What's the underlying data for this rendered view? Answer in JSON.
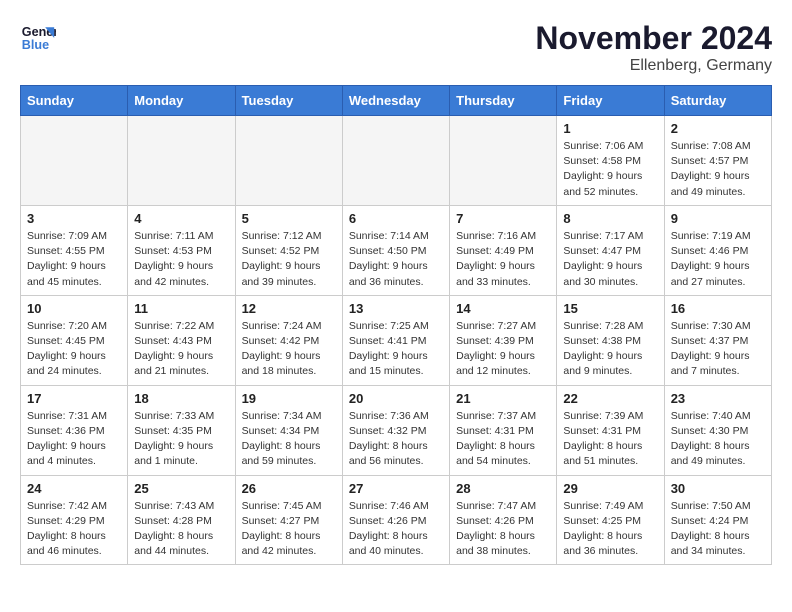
{
  "header": {
    "logo_line1": "General",
    "logo_line2": "Blue",
    "month_title": "November 2024",
    "location": "Ellenberg, Germany"
  },
  "weekdays": [
    "Sunday",
    "Monday",
    "Tuesday",
    "Wednesday",
    "Thursday",
    "Friday",
    "Saturday"
  ],
  "weeks": [
    [
      {
        "day": "",
        "info": ""
      },
      {
        "day": "",
        "info": ""
      },
      {
        "day": "",
        "info": ""
      },
      {
        "day": "",
        "info": ""
      },
      {
        "day": "",
        "info": ""
      },
      {
        "day": "1",
        "info": "Sunrise: 7:06 AM\nSunset: 4:58 PM\nDaylight: 9 hours\nand 52 minutes."
      },
      {
        "day": "2",
        "info": "Sunrise: 7:08 AM\nSunset: 4:57 PM\nDaylight: 9 hours\nand 49 minutes."
      }
    ],
    [
      {
        "day": "3",
        "info": "Sunrise: 7:09 AM\nSunset: 4:55 PM\nDaylight: 9 hours\nand 45 minutes."
      },
      {
        "day": "4",
        "info": "Sunrise: 7:11 AM\nSunset: 4:53 PM\nDaylight: 9 hours\nand 42 minutes."
      },
      {
        "day": "5",
        "info": "Sunrise: 7:12 AM\nSunset: 4:52 PM\nDaylight: 9 hours\nand 39 minutes."
      },
      {
        "day": "6",
        "info": "Sunrise: 7:14 AM\nSunset: 4:50 PM\nDaylight: 9 hours\nand 36 minutes."
      },
      {
        "day": "7",
        "info": "Sunrise: 7:16 AM\nSunset: 4:49 PM\nDaylight: 9 hours\nand 33 minutes."
      },
      {
        "day": "8",
        "info": "Sunrise: 7:17 AM\nSunset: 4:47 PM\nDaylight: 9 hours\nand 30 minutes."
      },
      {
        "day": "9",
        "info": "Sunrise: 7:19 AM\nSunset: 4:46 PM\nDaylight: 9 hours\nand 27 minutes."
      }
    ],
    [
      {
        "day": "10",
        "info": "Sunrise: 7:20 AM\nSunset: 4:45 PM\nDaylight: 9 hours\nand 24 minutes."
      },
      {
        "day": "11",
        "info": "Sunrise: 7:22 AM\nSunset: 4:43 PM\nDaylight: 9 hours\nand 21 minutes."
      },
      {
        "day": "12",
        "info": "Sunrise: 7:24 AM\nSunset: 4:42 PM\nDaylight: 9 hours\nand 18 minutes."
      },
      {
        "day": "13",
        "info": "Sunrise: 7:25 AM\nSunset: 4:41 PM\nDaylight: 9 hours\nand 15 minutes."
      },
      {
        "day": "14",
        "info": "Sunrise: 7:27 AM\nSunset: 4:39 PM\nDaylight: 9 hours\nand 12 minutes."
      },
      {
        "day": "15",
        "info": "Sunrise: 7:28 AM\nSunset: 4:38 PM\nDaylight: 9 hours\nand 9 minutes."
      },
      {
        "day": "16",
        "info": "Sunrise: 7:30 AM\nSunset: 4:37 PM\nDaylight: 9 hours\nand 7 minutes."
      }
    ],
    [
      {
        "day": "17",
        "info": "Sunrise: 7:31 AM\nSunset: 4:36 PM\nDaylight: 9 hours\nand 4 minutes."
      },
      {
        "day": "18",
        "info": "Sunrise: 7:33 AM\nSunset: 4:35 PM\nDaylight: 9 hours\nand 1 minute."
      },
      {
        "day": "19",
        "info": "Sunrise: 7:34 AM\nSunset: 4:34 PM\nDaylight: 8 hours\nand 59 minutes."
      },
      {
        "day": "20",
        "info": "Sunrise: 7:36 AM\nSunset: 4:32 PM\nDaylight: 8 hours\nand 56 minutes."
      },
      {
        "day": "21",
        "info": "Sunrise: 7:37 AM\nSunset: 4:31 PM\nDaylight: 8 hours\nand 54 minutes."
      },
      {
        "day": "22",
        "info": "Sunrise: 7:39 AM\nSunset: 4:31 PM\nDaylight: 8 hours\nand 51 minutes."
      },
      {
        "day": "23",
        "info": "Sunrise: 7:40 AM\nSunset: 4:30 PM\nDaylight: 8 hours\nand 49 minutes."
      }
    ],
    [
      {
        "day": "24",
        "info": "Sunrise: 7:42 AM\nSunset: 4:29 PM\nDaylight: 8 hours\nand 46 minutes."
      },
      {
        "day": "25",
        "info": "Sunrise: 7:43 AM\nSunset: 4:28 PM\nDaylight: 8 hours\nand 44 minutes."
      },
      {
        "day": "26",
        "info": "Sunrise: 7:45 AM\nSunset: 4:27 PM\nDaylight: 8 hours\nand 42 minutes."
      },
      {
        "day": "27",
        "info": "Sunrise: 7:46 AM\nSunset: 4:26 PM\nDaylight: 8 hours\nand 40 minutes."
      },
      {
        "day": "28",
        "info": "Sunrise: 7:47 AM\nSunset: 4:26 PM\nDaylight: 8 hours\nand 38 minutes."
      },
      {
        "day": "29",
        "info": "Sunrise: 7:49 AM\nSunset: 4:25 PM\nDaylight: 8 hours\nand 36 minutes."
      },
      {
        "day": "30",
        "info": "Sunrise: 7:50 AM\nSunset: 4:24 PM\nDaylight: 8 hours\nand 34 minutes."
      }
    ]
  ]
}
